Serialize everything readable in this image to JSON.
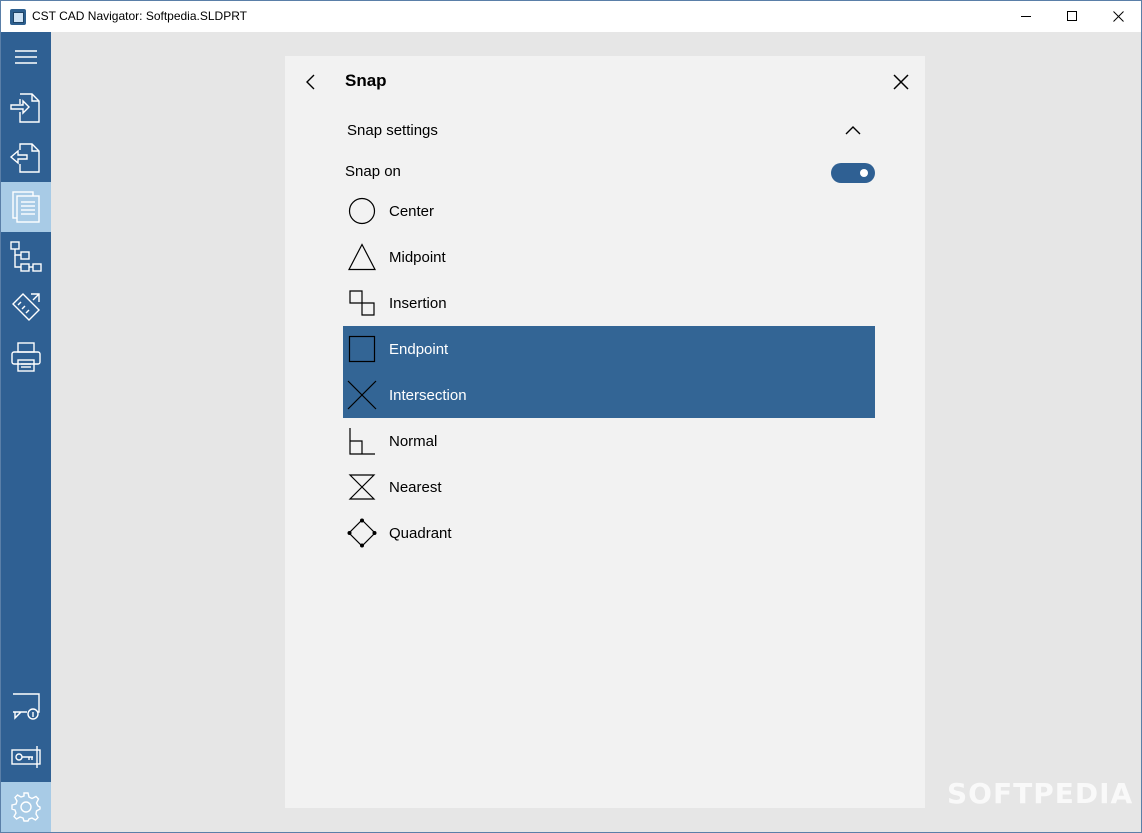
{
  "window": {
    "title": "CST CAD Navigator: Softpedia.SLDPRT"
  },
  "sidebar": {
    "top_items": [
      {
        "name": "menu-icon"
      },
      {
        "name": "import-icon"
      },
      {
        "name": "export-icon"
      },
      {
        "name": "document-icon",
        "active": true
      },
      {
        "name": "structure-tree-icon"
      },
      {
        "name": "measure-icon"
      },
      {
        "name": "print-icon"
      }
    ],
    "bottom_items": [
      {
        "name": "feedback-icon"
      },
      {
        "name": "license-key-icon"
      },
      {
        "name": "settings-gear-icon",
        "active": true
      }
    ]
  },
  "panel": {
    "title": "Snap",
    "section_header": "Snap settings",
    "snap_on_label": "Snap on",
    "snap_on": true,
    "items": [
      {
        "label": "Center",
        "icon": "circle-icon",
        "selected": false
      },
      {
        "label": "Midpoint",
        "icon": "triangle-icon",
        "selected": false
      },
      {
        "label": "Insertion",
        "icon": "insertion-icon",
        "selected": false
      },
      {
        "label": "Endpoint",
        "icon": "square-icon",
        "selected": true
      },
      {
        "label": "Intersection",
        "icon": "cross-icon",
        "selected": true
      },
      {
        "label": "Normal",
        "icon": "normal-icon",
        "selected": false
      },
      {
        "label": "Nearest",
        "icon": "hourglass-icon",
        "selected": false
      },
      {
        "label": "Quadrant",
        "icon": "diamond-icon",
        "selected": false
      }
    ],
    "colors": {
      "accent": "#2f6093",
      "selected_row": "#336595",
      "sidebar_active": "#a8cbe6"
    }
  },
  "watermark": "SOFTPEDIA"
}
